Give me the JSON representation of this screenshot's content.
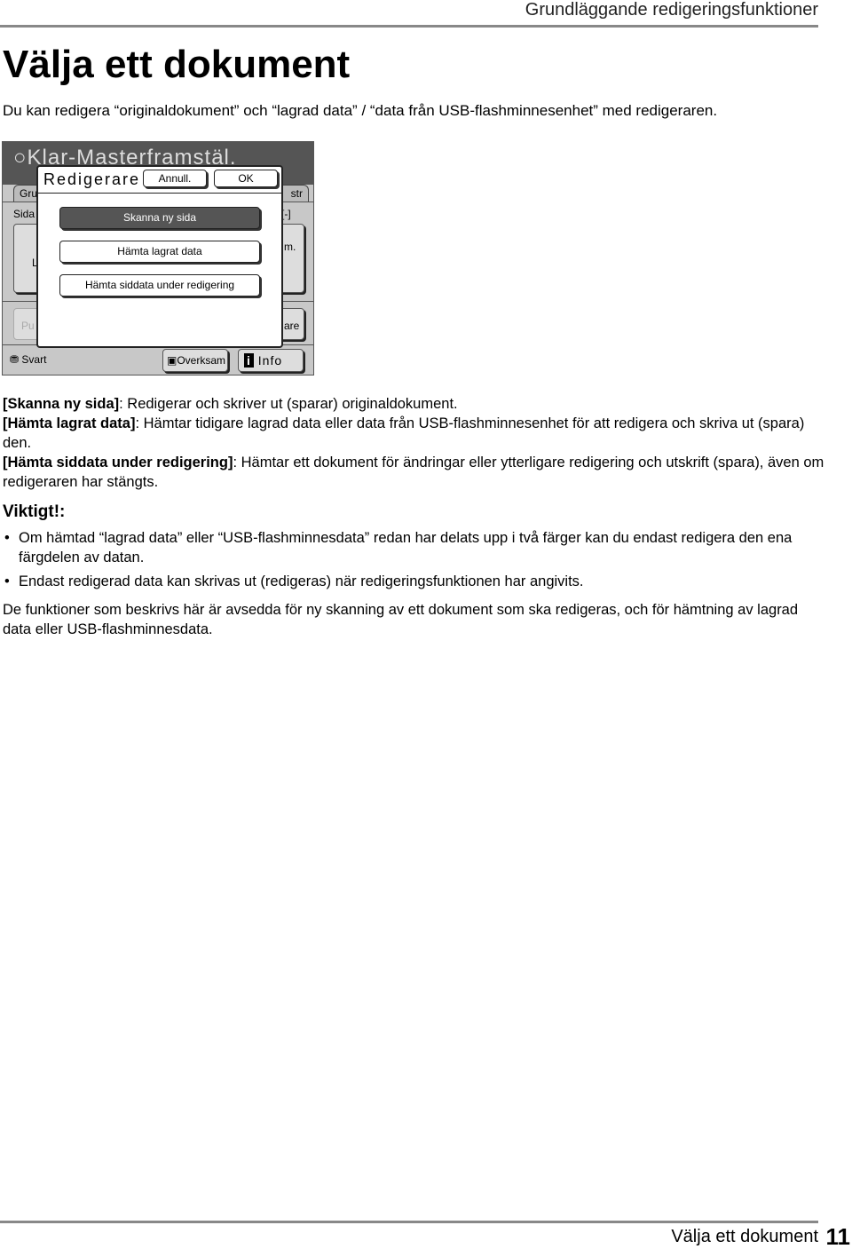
{
  "header": {
    "section": "Grundläggande redigeringsfunktioner"
  },
  "title": "Välja ett dokument",
  "intro": "Du kan redigera “originaldokument” och “lagrad data” / “data från USB-flashminnesenhet” med redigeraren.",
  "screen": {
    "status": "Klar-Masterframstäl.",
    "tabs": [
      "Gru",
      "str"
    ],
    "side_labels": {
      "sida": "Sida",
      "l": "L",
      "m": "m.",
      "bracket": "[-]",
      "pu": "Pu",
      "are": "are"
    },
    "dialog": {
      "title": "Redigerare",
      "cancel": "Annull.",
      "ok": "OK",
      "options": [
        "Skanna ny sida",
        "Hämta lagrat data",
        "Hämta siddata under redigering"
      ]
    },
    "bottom": {
      "color": "Svart",
      "idle": "Overksam",
      "info": "Info"
    }
  },
  "descriptions": [
    {
      "term": "[Skanna ny sida]",
      "text": ": Redigerar och skriver ut (sparar) originaldokument."
    },
    {
      "term": "[Hämta lagrat data]",
      "text": ": Hämtar tidigare lagrad data eller data från USB-flashminnesenhet för att redigera och skriva ut (spara) den."
    },
    {
      "term": "[Hämta siddata under redigering]",
      "text": ": Hämtar ett dokument för ändringar eller ytterligare redigering och utskrift (spara), även om redigeraren har stängts."
    }
  ],
  "important": {
    "heading": "Viktigt!:",
    "bullets": [
      "Om hämtad “lagrad data” eller “USB-flashminnesdata” redan har delats upp i två färger kan du endast redigera den ena färgdelen av datan.",
      "Endast redigerad data kan skrivas ut (redigeras) när redigeringsfunktionen har angivits."
    ]
  },
  "closing": "De funktioner som beskrivs här är avsedda för ny skanning av ett dokument som ska redigeras, och för hämtning av lagrad data eller USB-flashminnesdata.",
  "footer": {
    "title": "Välja ett dokument",
    "page": "11"
  }
}
